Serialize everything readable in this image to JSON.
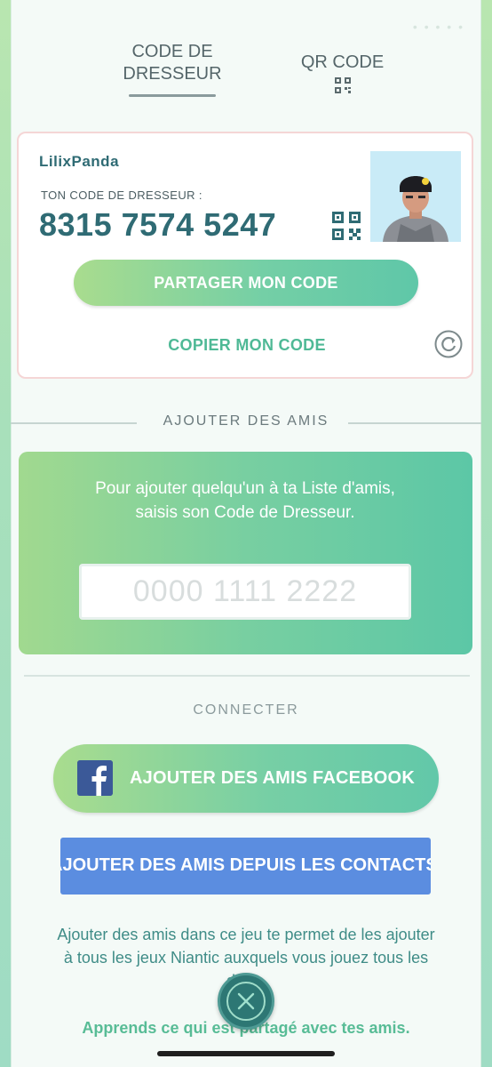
{
  "tabs": {
    "code": {
      "line1": "CODE DE",
      "line2": "DRESSEUR"
    },
    "qr": {
      "label": "QR CODE"
    }
  },
  "card": {
    "username": "LilixPanda",
    "code_label": "TON CODE DE DRESSEUR :",
    "code_value": "8315 7574 5247",
    "share_button": "PARTAGER MON CODE",
    "copy_link": "COPIER MON CODE"
  },
  "add_friends": {
    "section_title": "AJOUTER DES AMIS",
    "instructions": "Pour ajouter quelqu'un à ta Liste d'amis, saisis son Code de Dresseur.",
    "input_placeholder": "0000 1111 2222"
  },
  "connect": {
    "section_title": "CONNECTER",
    "facebook_button": "AJOUTER DES AMIS FACEBOOK",
    "contacts_button": "AJOUTER DES AMIS DEPUIS LES CONTACTS",
    "info_text": "Ajouter des amis dans ce jeu te permet de les ajouter à tous les jeux Niantic auxquels vous jouez tous les deux.",
    "learn_link": "Apprends ce qui est partagé avec tes amis."
  },
  "colors": {
    "accent_green": "#5fc7a8",
    "teal_text": "#2f6b74",
    "contacts_blue": "#5b8de0",
    "facebook_blue": "#3b5998"
  },
  "icons": [
    "qr-code-icon",
    "refresh-icon",
    "facebook-icon",
    "close-icon"
  ]
}
